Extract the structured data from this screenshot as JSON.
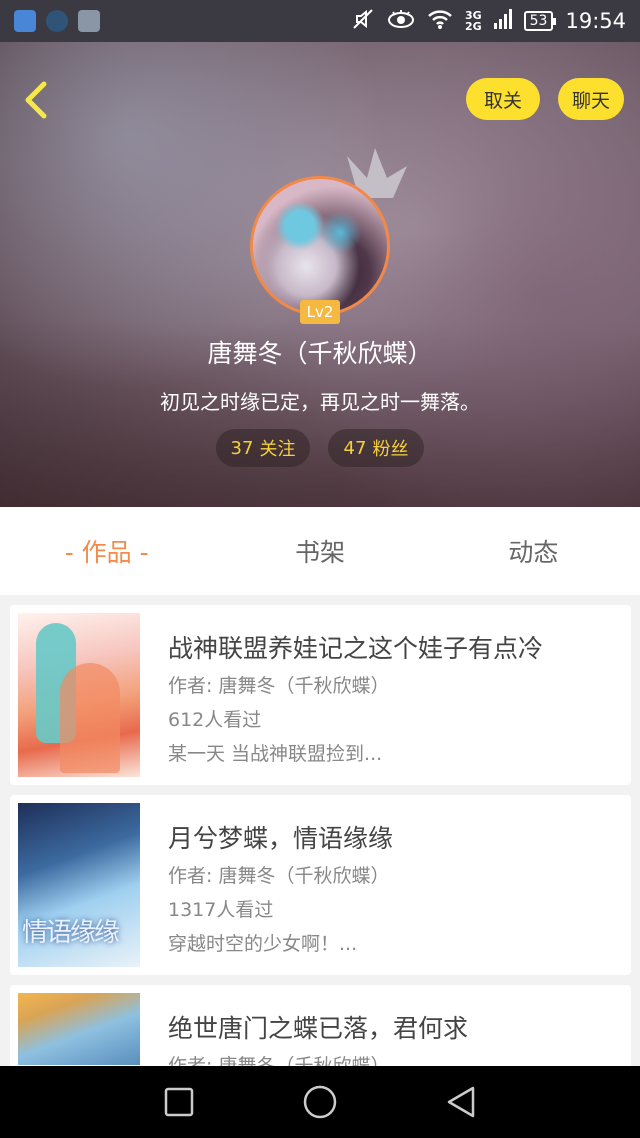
{
  "status_bar": {
    "net_top": "3G",
    "net_bottom": "2G",
    "battery": "53",
    "time": "19:54"
  },
  "header": {
    "unfollow_label": "取关",
    "chat_label": "聊天",
    "level": "Lv2",
    "nickname": "唐舞冬（千秋欣蝶）",
    "signature": "初见之时缘已定，再见之时一舞落。",
    "following": {
      "count": "37",
      "label": "关注"
    },
    "fans": {
      "count": "47",
      "label": "粉丝"
    }
  },
  "tabs": [
    {
      "label": "- 作品 -",
      "active": true
    },
    {
      "label": "书架",
      "active": false
    },
    {
      "label": "动态",
      "active": false
    }
  ],
  "works": [
    {
      "title": "战神联盟养娃记之这个娃子有点冷",
      "author": "作者: 唐舞冬（千秋欣蝶）",
      "views": "612人看过",
      "desc": "某一天 当战神联盟捡到..."
    },
    {
      "title": "月兮梦蝶，情语缘缘",
      "author": "作者: 唐舞冬（千秋欣蝶）",
      "views": "1317人看过",
      "desc": "穿越时空的少女啊！..."
    },
    {
      "title": "绝世唐门之蝶已落，君何求",
      "author": "作者: 唐舞冬（千秋欣蝶）",
      "views": "",
      "desc": ""
    }
  ],
  "colors": {
    "accent": "#f28c4c",
    "button_yellow": "#fde02e",
    "stat_text": "#f5d13a"
  }
}
